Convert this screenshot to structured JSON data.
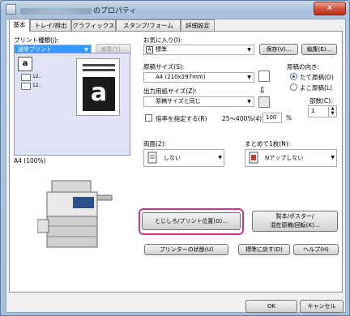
{
  "window": {
    "title_suffix": "のプロパティ",
    "close_glyph": "✕"
  },
  "tabs": [
    {
      "label": "基本"
    },
    {
      "label": "トレイ/排出"
    },
    {
      "label": "グラフィックス"
    },
    {
      "label": "スタンプ/フォーム"
    },
    {
      "label": "詳細設定"
    }
  ],
  "print_type": {
    "label": "プリント種類(J):",
    "value": "通常プリント",
    "edit_button": "編集(T)..."
  },
  "favorites": {
    "label": "お気に入り(I):",
    "value": "標準",
    "save_button": "保存(V)...",
    "edit_button": "編集(E)..."
  },
  "preview": {
    "paper_glyph": "a",
    "stack_glyph": "a",
    "caption": "A4 (100%)",
    "mini_labels": [
      "12..",
      "12.."
    ]
  },
  "paper_size": {
    "label": "原稿サイズ(S):",
    "value": "A4 (210x297mm)"
  },
  "output_size": {
    "label": "出力用紙サイズ(Z):",
    "value": "原稿サイズと同じ"
  },
  "scale": {
    "checkbox_label": "倍率を指定する(R)",
    "range": "25〜400%(4):",
    "value": "100",
    "unit": "%"
  },
  "orientation": {
    "label": "原稿の向き:",
    "portrait": "たて原稿(O)",
    "landscape": "よこ原稿(L)"
  },
  "copies": {
    "label": "部数(C):",
    "value": "1"
  },
  "duplex": {
    "label": "両面(2):",
    "value": "しない"
  },
  "nup": {
    "label": "まとめて1枚(N):",
    "value": "Nアップしない"
  },
  "buttons": {
    "binding": "とじしろ/プリント位置(G)...",
    "booklet_line1": "製本/ポスター/",
    "booklet_line2": "混在原稿/回転(K)...",
    "printer_status": "プリンターの状態(U)",
    "restore": "標準に戻す(D)",
    "help": "ヘルプ(H)",
    "ok": "OK",
    "cancel": "キャンセル"
  },
  "colors": {
    "highlight": "#d42e8a",
    "selection": "#3399ff"
  }
}
